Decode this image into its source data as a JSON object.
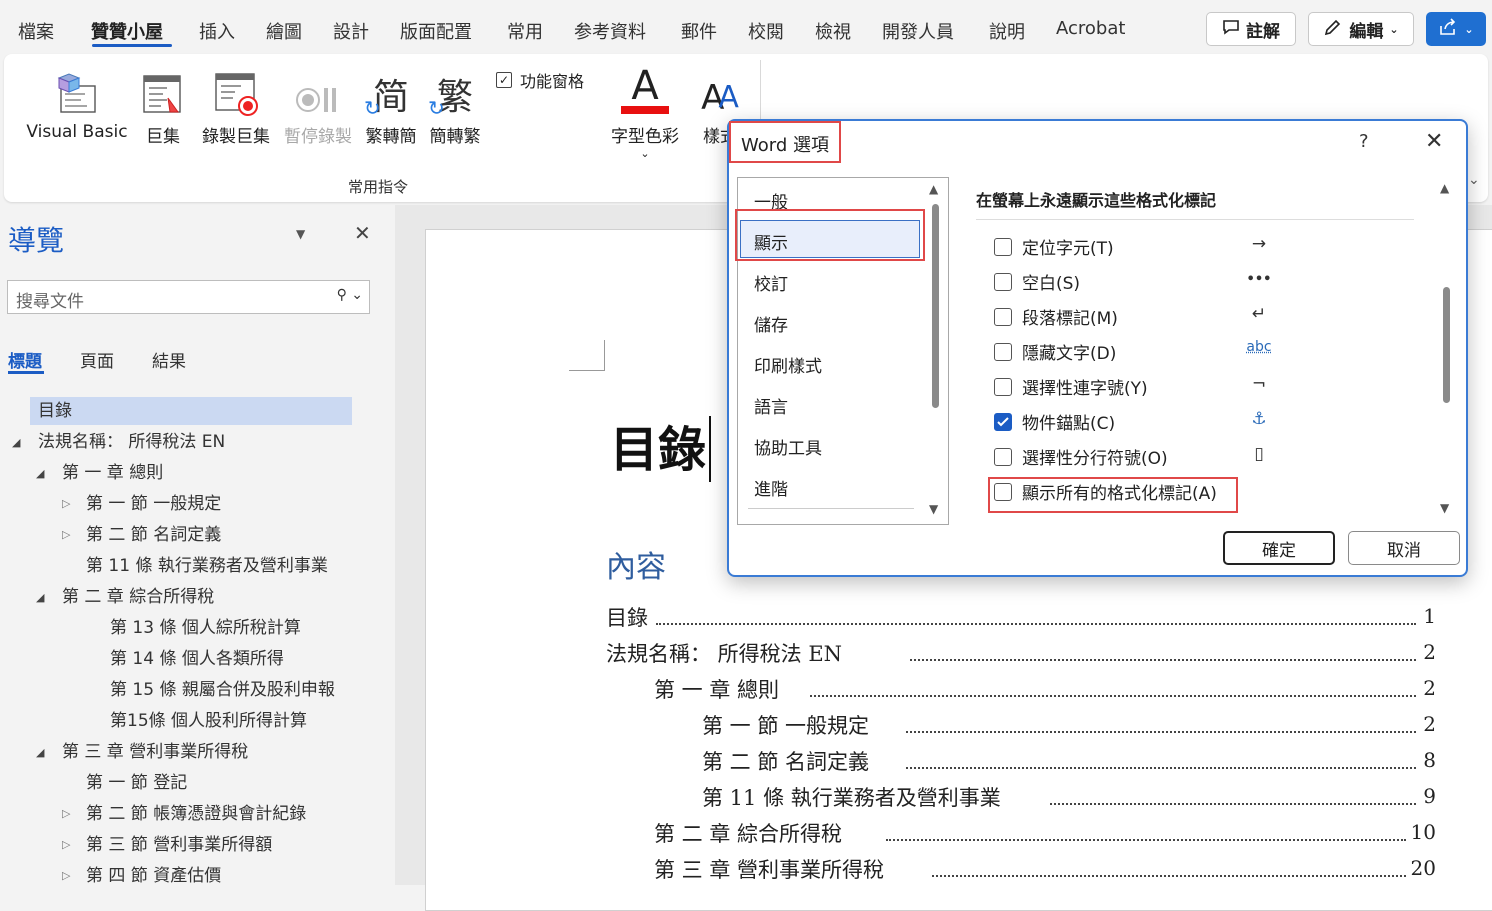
{
  "menu": {
    "tabs": [
      "檔案",
      "贊贊小屋",
      "插入",
      "繪圖",
      "設計",
      "版面配置",
      "常用",
      "参考資料",
      "郵件",
      "校閱",
      "檢視",
      "開發人員",
      "說明",
      "Acrobat"
    ],
    "comment_label": "註解",
    "edit_label": "編輯"
  },
  "ribbon": {
    "visual_basic": "Visual Basic",
    "macros": "巨集",
    "record_macro": "錄製巨集",
    "pause_recording": "暫停錄製",
    "trad_to_simp": "繁轉簡",
    "simp_to_trad": "簡轉繁",
    "function_pane": "功能窗格",
    "font_color": "字型色彩",
    "style_partial": "樣式",
    "group_label": "常用指令",
    "icon_simp_glyph": "简",
    "icon_trad_glyph": "繁"
  },
  "nav": {
    "title": "導覽",
    "search_placeholder": "搜尋文件",
    "tabs": [
      "標題",
      "頁面",
      "結果"
    ],
    "items": [
      {
        "text": "目錄"
      },
      {
        "text": "法規名稱：  所得稅法 EN"
      },
      {
        "text": "第 一 章 總則"
      },
      {
        "text": "第 一 節 一般規定"
      },
      {
        "text": "第 二 節 名詞定義"
      },
      {
        "text": "第 11 條 執行業務者及營利事業"
      },
      {
        "text": "第 二 章 綜合所得稅"
      },
      {
        "text": "第 13 條 個人綜所稅計算"
      },
      {
        "text": "第 14 條 個人各類所得"
      },
      {
        "text": "第 15 條 親屬合併及股利申報"
      },
      {
        "text": "第15條 個人股利所得計算"
      },
      {
        "text": "第 三 章 營利事業所得稅"
      },
      {
        "text": "第 一 節 登記"
      },
      {
        "text": "第 二 節 帳簿憑證與會計紀錄"
      },
      {
        "text": "第 三 節 營利事業所得額"
      },
      {
        "text": "第 四 節 資產估價"
      }
    ]
  },
  "document": {
    "heading": "目錄",
    "toc_title": "內容",
    "toc": [
      {
        "text": "目錄",
        "page": "1"
      },
      {
        "text": "法規名稱：      所得稅法  EN",
        "page": "2"
      },
      {
        "text": "第 一 章  總則",
        "page": "2"
      },
      {
        "text": "第 一 節  一般規定",
        "page": "2"
      },
      {
        "text": "第 二 節  名詞定義",
        "page": "8"
      },
      {
        "text": "第  11  條  執行業務者及營利事業",
        "page": "9"
      },
      {
        "text": "第 二 章  綜合所得稅",
        "page": "10"
      },
      {
        "text": "第 三 章  營利事業所得稅",
        "page": "20"
      }
    ]
  },
  "dialog": {
    "title": "Word 選項",
    "help": "?",
    "categories": [
      "一般",
      "顯示",
      "校訂",
      "儲存",
      "印刷樣式",
      "語言",
      "協助工具",
      "進階"
    ],
    "section_title": "在螢幕上永遠顯示這些格式化標記",
    "options": [
      {
        "label": "定位字元(T)",
        "checked": false,
        "symbol": "→"
      },
      {
        "label": "空白(S)",
        "checked": false,
        "symbol": "•••"
      },
      {
        "label": "段落標記(M)",
        "checked": false,
        "symbol": "↵"
      },
      {
        "label": "隱藏文字(D)",
        "checked": false,
        "symbol": "abc"
      },
      {
        "label": "選擇性連字號(Y)",
        "checked": false,
        "symbol": "¬"
      },
      {
        "label": "物件錨點(C)",
        "checked": true,
        "symbol": "⚓"
      },
      {
        "label": "選擇性分行符號(O)",
        "checked": false,
        "symbol": "▯"
      },
      {
        "label": "顯示所有的格式化標記(A)",
        "checked": false,
        "symbol": ""
      }
    ],
    "ok_label": "確定",
    "cancel_label": "取消"
  },
  "colors": {
    "accent": "#1b5cc4",
    "highlight_box": "#e04848",
    "font_color_bar": "#e81010",
    "dialog_border": "#3a7bd5"
  }
}
